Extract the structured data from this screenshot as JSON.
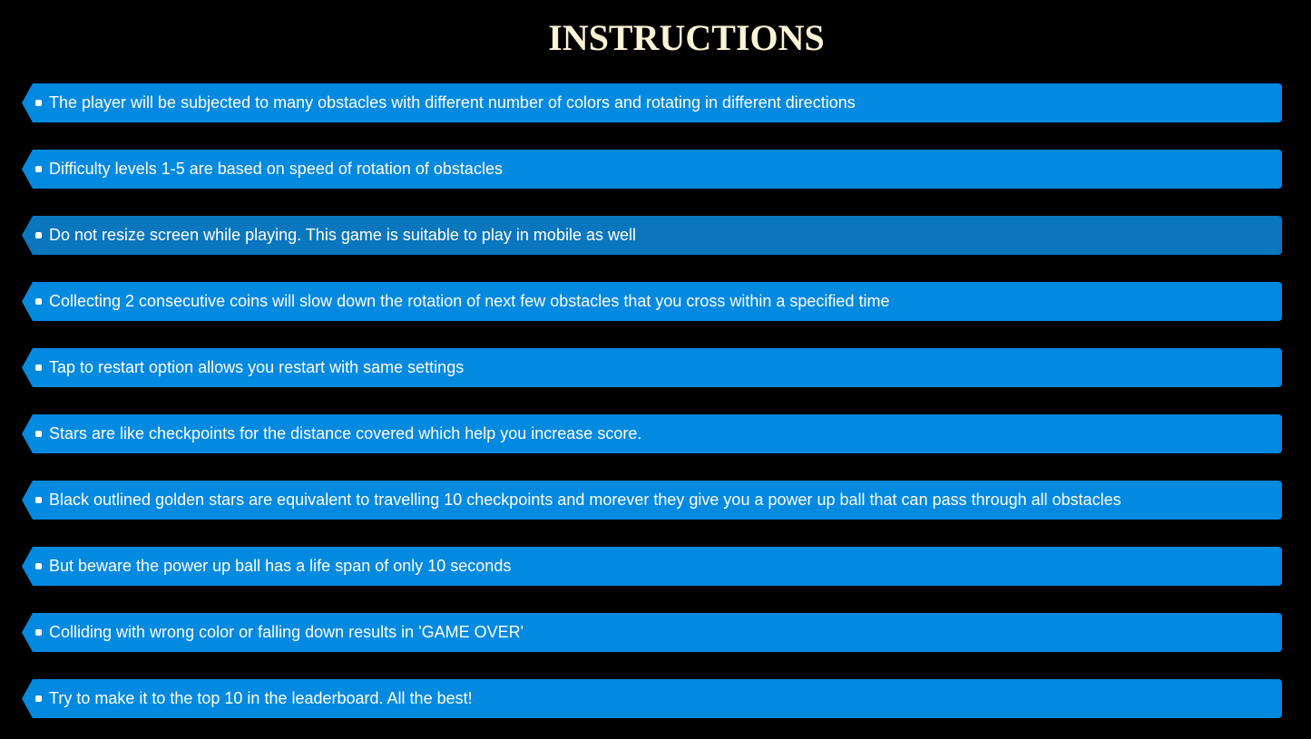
{
  "title": "INSTRUCTIONS",
  "colors": {
    "background": "#000000",
    "title": "#fff3d6",
    "item_background": "#0289e0",
    "item_hover_background": "#0b80cf",
    "item_text": "#ffffff"
  },
  "icons": {
    "bullet": "square-bullet-icon"
  },
  "hovered_index": 2,
  "instructions": [
    "The player will be subjected to many obstacles with different number of colors and rotating in different directions",
    "Difficulty levels 1-5 are based on speed of rotation of obstacles",
    "Do not resize screen while playing. This game is suitable to play in mobile as well",
    "Collecting 2 consecutive coins will slow down the rotation of next few obstacles that you cross within a specified time",
    "Tap to restart option allows you restart with same settings",
    "Stars are like checkpoints for the distance covered which help you increase score.",
    "Black outlined golden stars are equivalent to travelling 10 checkpoints and morever they give you a power up ball that can pass through all obstacles",
    "But beware the power up ball has a life span of only 10 seconds",
    "Colliding with wrong color or falling down results in 'GAME OVER'",
    "Try to make it to the top 10 in the leaderboard. All the best!"
  ]
}
